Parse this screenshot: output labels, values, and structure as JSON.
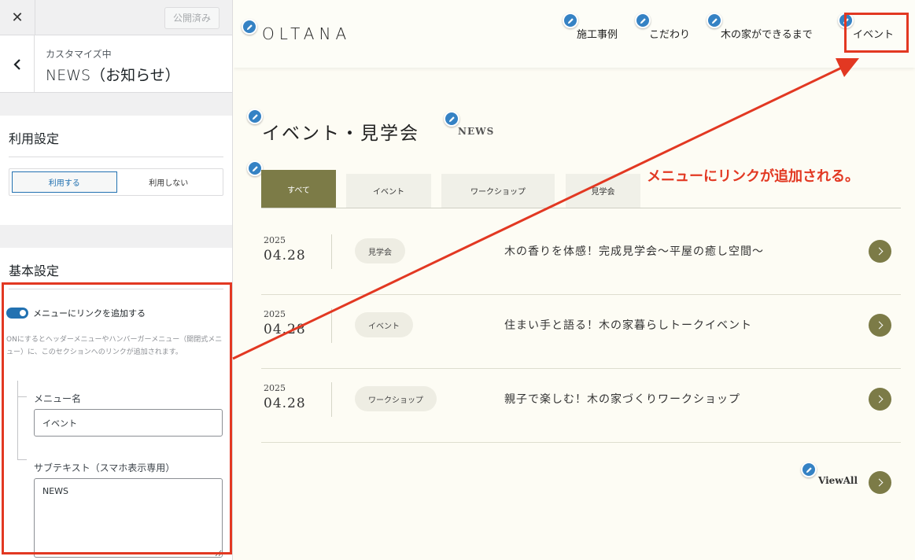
{
  "customizer": {
    "close_label": "✕",
    "publish_label": "公開済み",
    "breadcrumb_sub": "カスタマイズ中",
    "breadcrumb_title": "NEWS（お知らせ）",
    "usage_section": {
      "title": "利用設定",
      "options": [
        "利用する",
        "利用しない"
      ],
      "selected": "利用する"
    },
    "basic_section": {
      "title": "基本設定",
      "toggle_label": "メニューにリンクを追加する",
      "toggle_on": true,
      "help_text": "ONにするとヘッダーメニューやハンバーガーメニュー（開閉式メニュー）に、このセクションへのリンクが追加されます。",
      "menu_name_label": "メニュー名",
      "menu_name_value": "イベント",
      "subtext_label": "サブテキスト（スマホ表示専用）",
      "subtext_value": "NEWS"
    }
  },
  "site": {
    "logo": "OLTANA",
    "nav": [
      "施工事例",
      "こだわり",
      "木の家ができるまで",
      "イベント"
    ],
    "section_title": "イベント・見学会",
    "section_sub": "NEWS",
    "tabs": [
      "すべて",
      "イベント",
      "ワークショップ",
      "見学会"
    ],
    "active_tab": "すべて",
    "news": [
      {
        "year": "2025",
        "date": "04.28",
        "category": "見学会",
        "title": "木の香りを体感！完成見学会〜平屋の癒し空間〜"
      },
      {
        "year": "2025",
        "date": "04.28",
        "category": "イベント",
        "title": "住まい手と語る！木の家暮らしトークイベント"
      },
      {
        "year": "2025",
        "date": "04.28",
        "category": "ワークショップ",
        "title": "親子で楽しむ！木の家づくりワークショップ"
      }
    ],
    "view_all": "ViewAll"
  },
  "annotation": {
    "callout_text": "メニューにリンクが追加される。",
    "color": "#e23822"
  },
  "colors": {
    "accent_olive": "#7c7b47",
    "wp_blue": "#2271b1",
    "annotation_red": "#e23822"
  }
}
